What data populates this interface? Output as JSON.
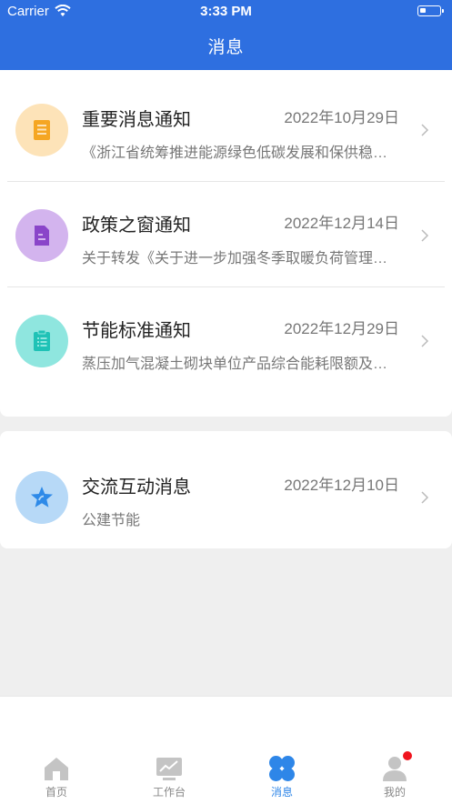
{
  "status_bar": {
    "carrier": "Carrier",
    "time": "3:33 PM"
  },
  "header": {
    "title": "消息"
  },
  "notifications": [
    {
      "title": "重要消息通知",
      "date": "2022年10月29日",
      "summary": "《浙江省统筹推进能源绿色低碳发展和保供稳…",
      "icon": "receipt-icon",
      "color": "#fde3b8",
      "icon_color": "#f5a623"
    },
    {
      "title": "政策之窗通知",
      "date": "2022年12月14日",
      "summary": "关于转发《关于进一步加强冬季取暖负荷管理…",
      "icon": "document-icon",
      "color": "#d3b4ee",
      "icon_color": "#8a45c9"
    },
    {
      "title": "节能标准通知",
      "date": "2022年12月29日",
      "summary": "蒸压加气混凝土砌块单位产品综合能耗限额及…",
      "icon": "clipboard-icon",
      "color": "#8fe6df",
      "icon_color": "#1fc2b6"
    }
  ],
  "interaction": {
    "title": "交流互动消息",
    "date": "2022年12月10日",
    "summary": "公建节能",
    "icon": "star-icon",
    "color": "#b7d9f7",
    "icon_color": "#2e8ae8"
  },
  "tabbar": {
    "tabs": [
      {
        "label": "首页",
        "icon": "home-icon"
      },
      {
        "label": "工作台",
        "icon": "workbench-icon"
      },
      {
        "label": "消息",
        "icon": "message-icon",
        "active": true
      },
      {
        "label": "我的",
        "icon": "profile-icon"
      }
    ],
    "active_color": "#2e86e8",
    "badge_color": "#f0141e"
  }
}
